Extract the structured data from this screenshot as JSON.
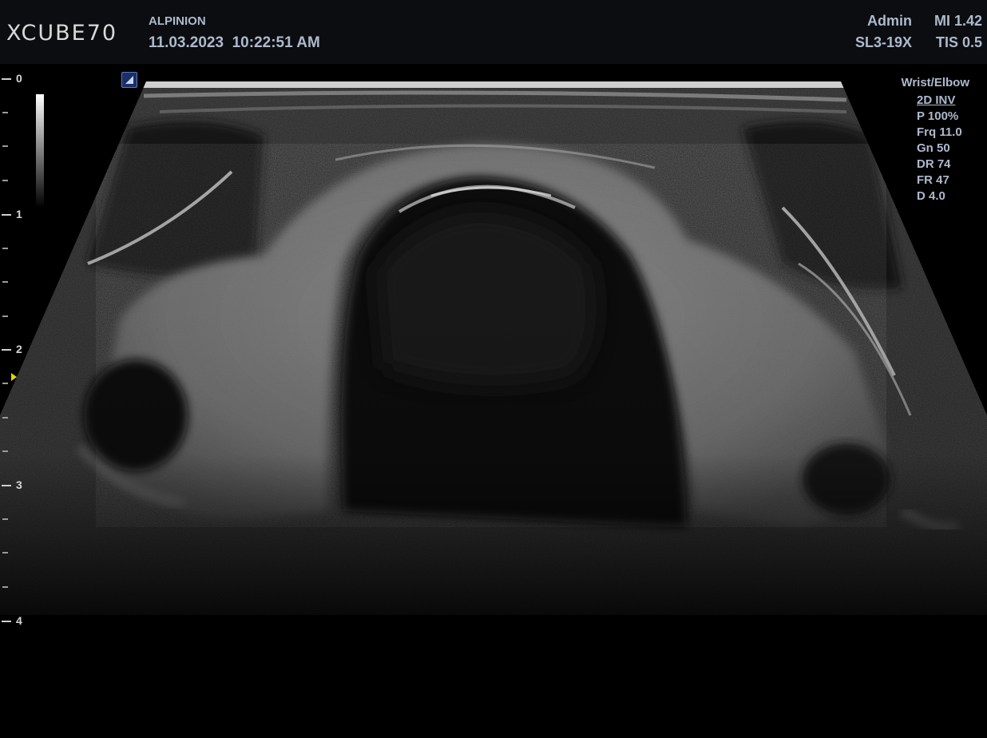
{
  "header": {
    "logo": "XCUBE70",
    "hospital": "ALPINION",
    "datetime": "11.03.2023  10:22:51 AM",
    "user": "Admin",
    "mi": "MI 1.42",
    "probe": "SL3-19X",
    "tis": "TIS 0.5"
  },
  "depth_scale": {
    "labels": [
      "0",
      "1",
      "2",
      "3",
      "4"
    ]
  },
  "params": {
    "preset": "Wrist/Elbow",
    "mode": "2D INV",
    "power": "P 100%",
    "frequency": "Frq 11.0",
    "gain": "Gn 50",
    "dynamic_range": "DR 74",
    "frame_rate": "FR 47",
    "depth": "D 4.0"
  },
  "colors": {
    "overlay_text": "#aeb9cc",
    "header_bg": "#0b0d10",
    "focus_marker": "#e6d400",
    "orientation_mark": "#1b2f66"
  },
  "icons": {
    "orientation": "probe-orientation-icon",
    "focus": "focus-marker-icon"
  }
}
